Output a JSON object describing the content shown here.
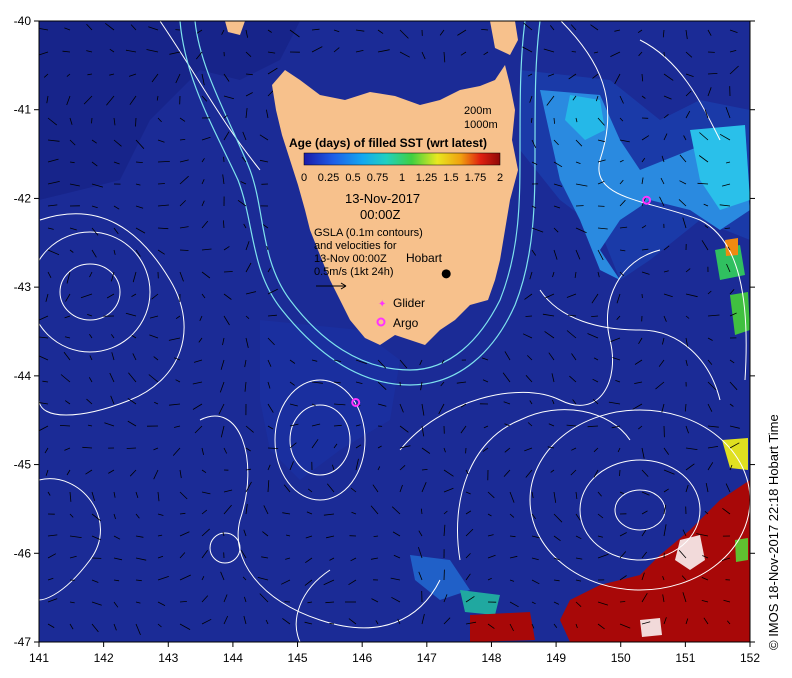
{
  "map": {
    "x_ticks": [
      "141",
      "142",
      "143",
      "144",
      "145",
      "146",
      "147",
      "148",
      "149",
      "150",
      "151",
      "152"
    ],
    "y_ticks": [
      "-40",
      "-41",
      "-42",
      "-43",
      "-44",
      "-45",
      "-46",
      "-47"
    ],
    "x_range": [
      141,
      152
    ],
    "y_range": [
      -47,
      -40
    ],
    "colors": {
      "ocean_base": "#1b2b96",
      "land": "#f7c18c",
      "contour": "#ffffff",
      "bathy": "#7fe3ee",
      "glider": "#ff33ff",
      "argo": "#ff33ff",
      "hobart": "#000000",
      "warm_patch": "#a80808"
    }
  },
  "legend": {
    "bathy_200": "200m",
    "bathy_1000": "1000m",
    "colorbar_title": "Age (days) of filled SST (wrt latest)",
    "colorbar_ticks": [
      "0",
      "0.25",
      "0.5",
      "0.75",
      "1",
      "1.25",
      "1.5",
      "1.75",
      "2"
    ],
    "date_line1": "13-Nov-2017",
    "date_line2": "00:00Z",
    "gsla_line1": "GSLA (0.1m contours)",
    "gsla_line2": "and velocities for",
    "gsla_line3": "13-Nov 00:00Z",
    "hobart_label": "Hobart",
    "velocity_scale": "0.5m/s (1kt 24h)",
    "glider_label": "Glider",
    "argo_label": "Argo"
  },
  "markers": {
    "hobart": {
      "lon": 147.3,
      "lat": -42.85
    },
    "argo_1": {
      "lon": 150.4,
      "lat": -42.02
    },
    "argo_2": {
      "lon": 145.9,
      "lat": -44.3
    }
  },
  "credit": "© IMOS 18-Nov-2017 22:18 Hobart Time"
}
